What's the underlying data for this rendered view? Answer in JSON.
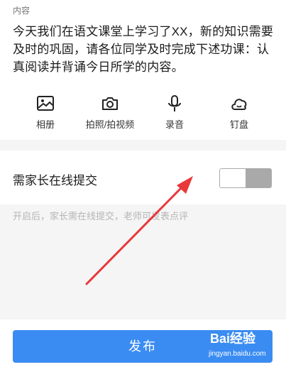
{
  "content": {
    "label": "内容",
    "text": "今天我们在语文课堂上学习了XX，新的知识需要及时的巩固，请各位同学及时完成下述功课：认真阅读并背诵今日所学的内容。"
  },
  "tools": [
    {
      "icon": "image-icon",
      "label": "相册"
    },
    {
      "icon": "camera-icon",
      "label": "拍照/拍视频"
    },
    {
      "icon": "microphone-icon",
      "label": "录音"
    },
    {
      "icon": "cloud-drive-icon",
      "label": "钉盘"
    }
  ],
  "parent_submit": {
    "title": "需家长在线提交",
    "enabled": false,
    "hint": "开启后，家长需在线提交，老师可发表点评"
  },
  "publish_label": "发布",
  "watermark": {
    "brand": "Bai经验",
    "url": "jingyan.baidu.com"
  },
  "colors": {
    "accent": "#3a8cf2",
    "arrow": "#e8383b"
  }
}
